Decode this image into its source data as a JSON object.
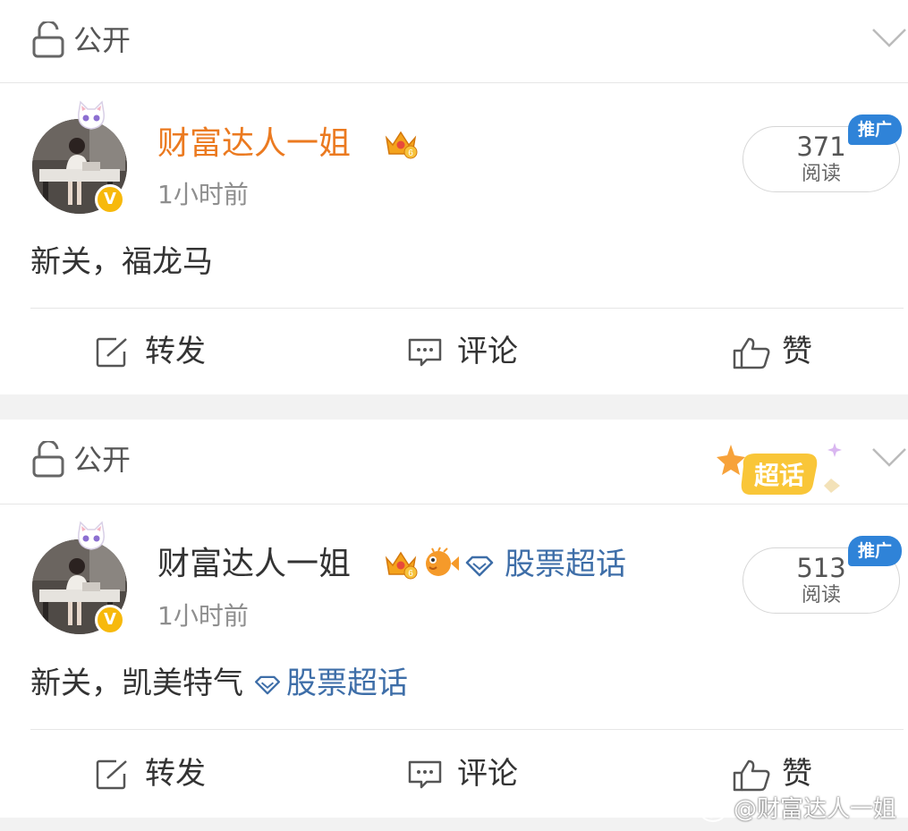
{
  "posts": [
    {
      "visibility": "公开",
      "author": "财富达人一姐",
      "time": "1小时前",
      "reads": "371",
      "reads_label": "阅读",
      "promo_badge": "推广",
      "content_text": "新关，福龙马",
      "actions": {
        "repost": "转发",
        "comment": "评论",
        "like": "赞"
      },
      "icons": [
        "lock-icon",
        "chevron-down-icon",
        "crown-badge-icon",
        "verified-v-icon",
        "repost-icon",
        "comment-icon",
        "like-icon"
      ]
    },
    {
      "visibility": "公开",
      "author": "财富达人一姐",
      "topic_tag": "股票超话",
      "time": "1小时前",
      "reads": "513",
      "reads_label": "阅读",
      "promo_badge": "推广",
      "super_topic_badge": "超话",
      "content_text": "新关，凯美特气",
      "content_topic": "股票超话",
      "actions": {
        "repost": "转发",
        "comment": "评论",
        "like": "赞"
      },
      "icons": [
        "lock-icon",
        "chevron-down-icon",
        "crown-badge-icon",
        "pufferfish-badge-icon",
        "diamond-icon",
        "verified-v-icon",
        "repost-icon",
        "comment-icon",
        "like-icon"
      ]
    }
  ],
  "watermark": "@财富达人一姐",
  "colors": {
    "author_vip": "#eb7a20",
    "topic_link": "#3e6ea8",
    "promo_blue": "#2f83d8",
    "verified_gold": "#f7b90c"
  }
}
